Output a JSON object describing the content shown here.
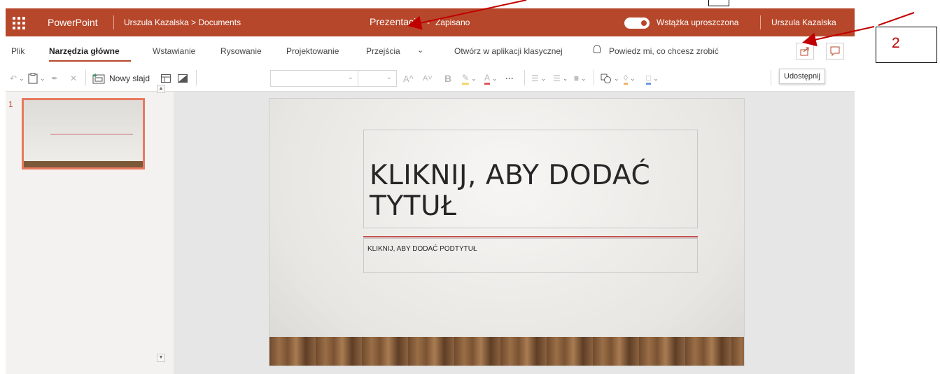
{
  "titlebar": {
    "app_name": "PowerPoint",
    "breadcrumb": "Urszula Kazalska > Documents",
    "doc_title": "Prezentacja",
    "dash": "-",
    "status": "Zapisano",
    "toggle_label": "Wstążka uproszczona",
    "user": "Urszula Kazalska"
  },
  "tabs": [
    {
      "label": "Plik"
    },
    {
      "label": "Narzędzia główne"
    },
    {
      "label": "Wstawianie"
    },
    {
      "label": "Rysowanie"
    },
    {
      "label": "Projektowanie"
    },
    {
      "label": "Przejścia"
    },
    {
      "label": "Otwórz w aplikacji klasycznej"
    },
    {
      "label": "Powiedz mi, co chcesz zrobić"
    }
  ],
  "toolbar": {
    "new_slide": "Nowy slajd",
    "grow_font": "A^",
    "shrink_font": "A˅",
    "bold": "B",
    "more": "···",
    "share_tooltip": "Udostępnij"
  },
  "thumbs": {
    "slide_number": "1"
  },
  "slide": {
    "title": "KLIKNIJ, ABY DODAĆ TYTUŁ",
    "subtitle": "KLIKNIJ, ABY DODAĆ PODTYTUŁ"
  },
  "annotation": {
    "number": "2"
  },
  "colors": {
    "brand": "#b7472a",
    "annotation_red": "#c00000",
    "accent_line": "#c0504d"
  }
}
